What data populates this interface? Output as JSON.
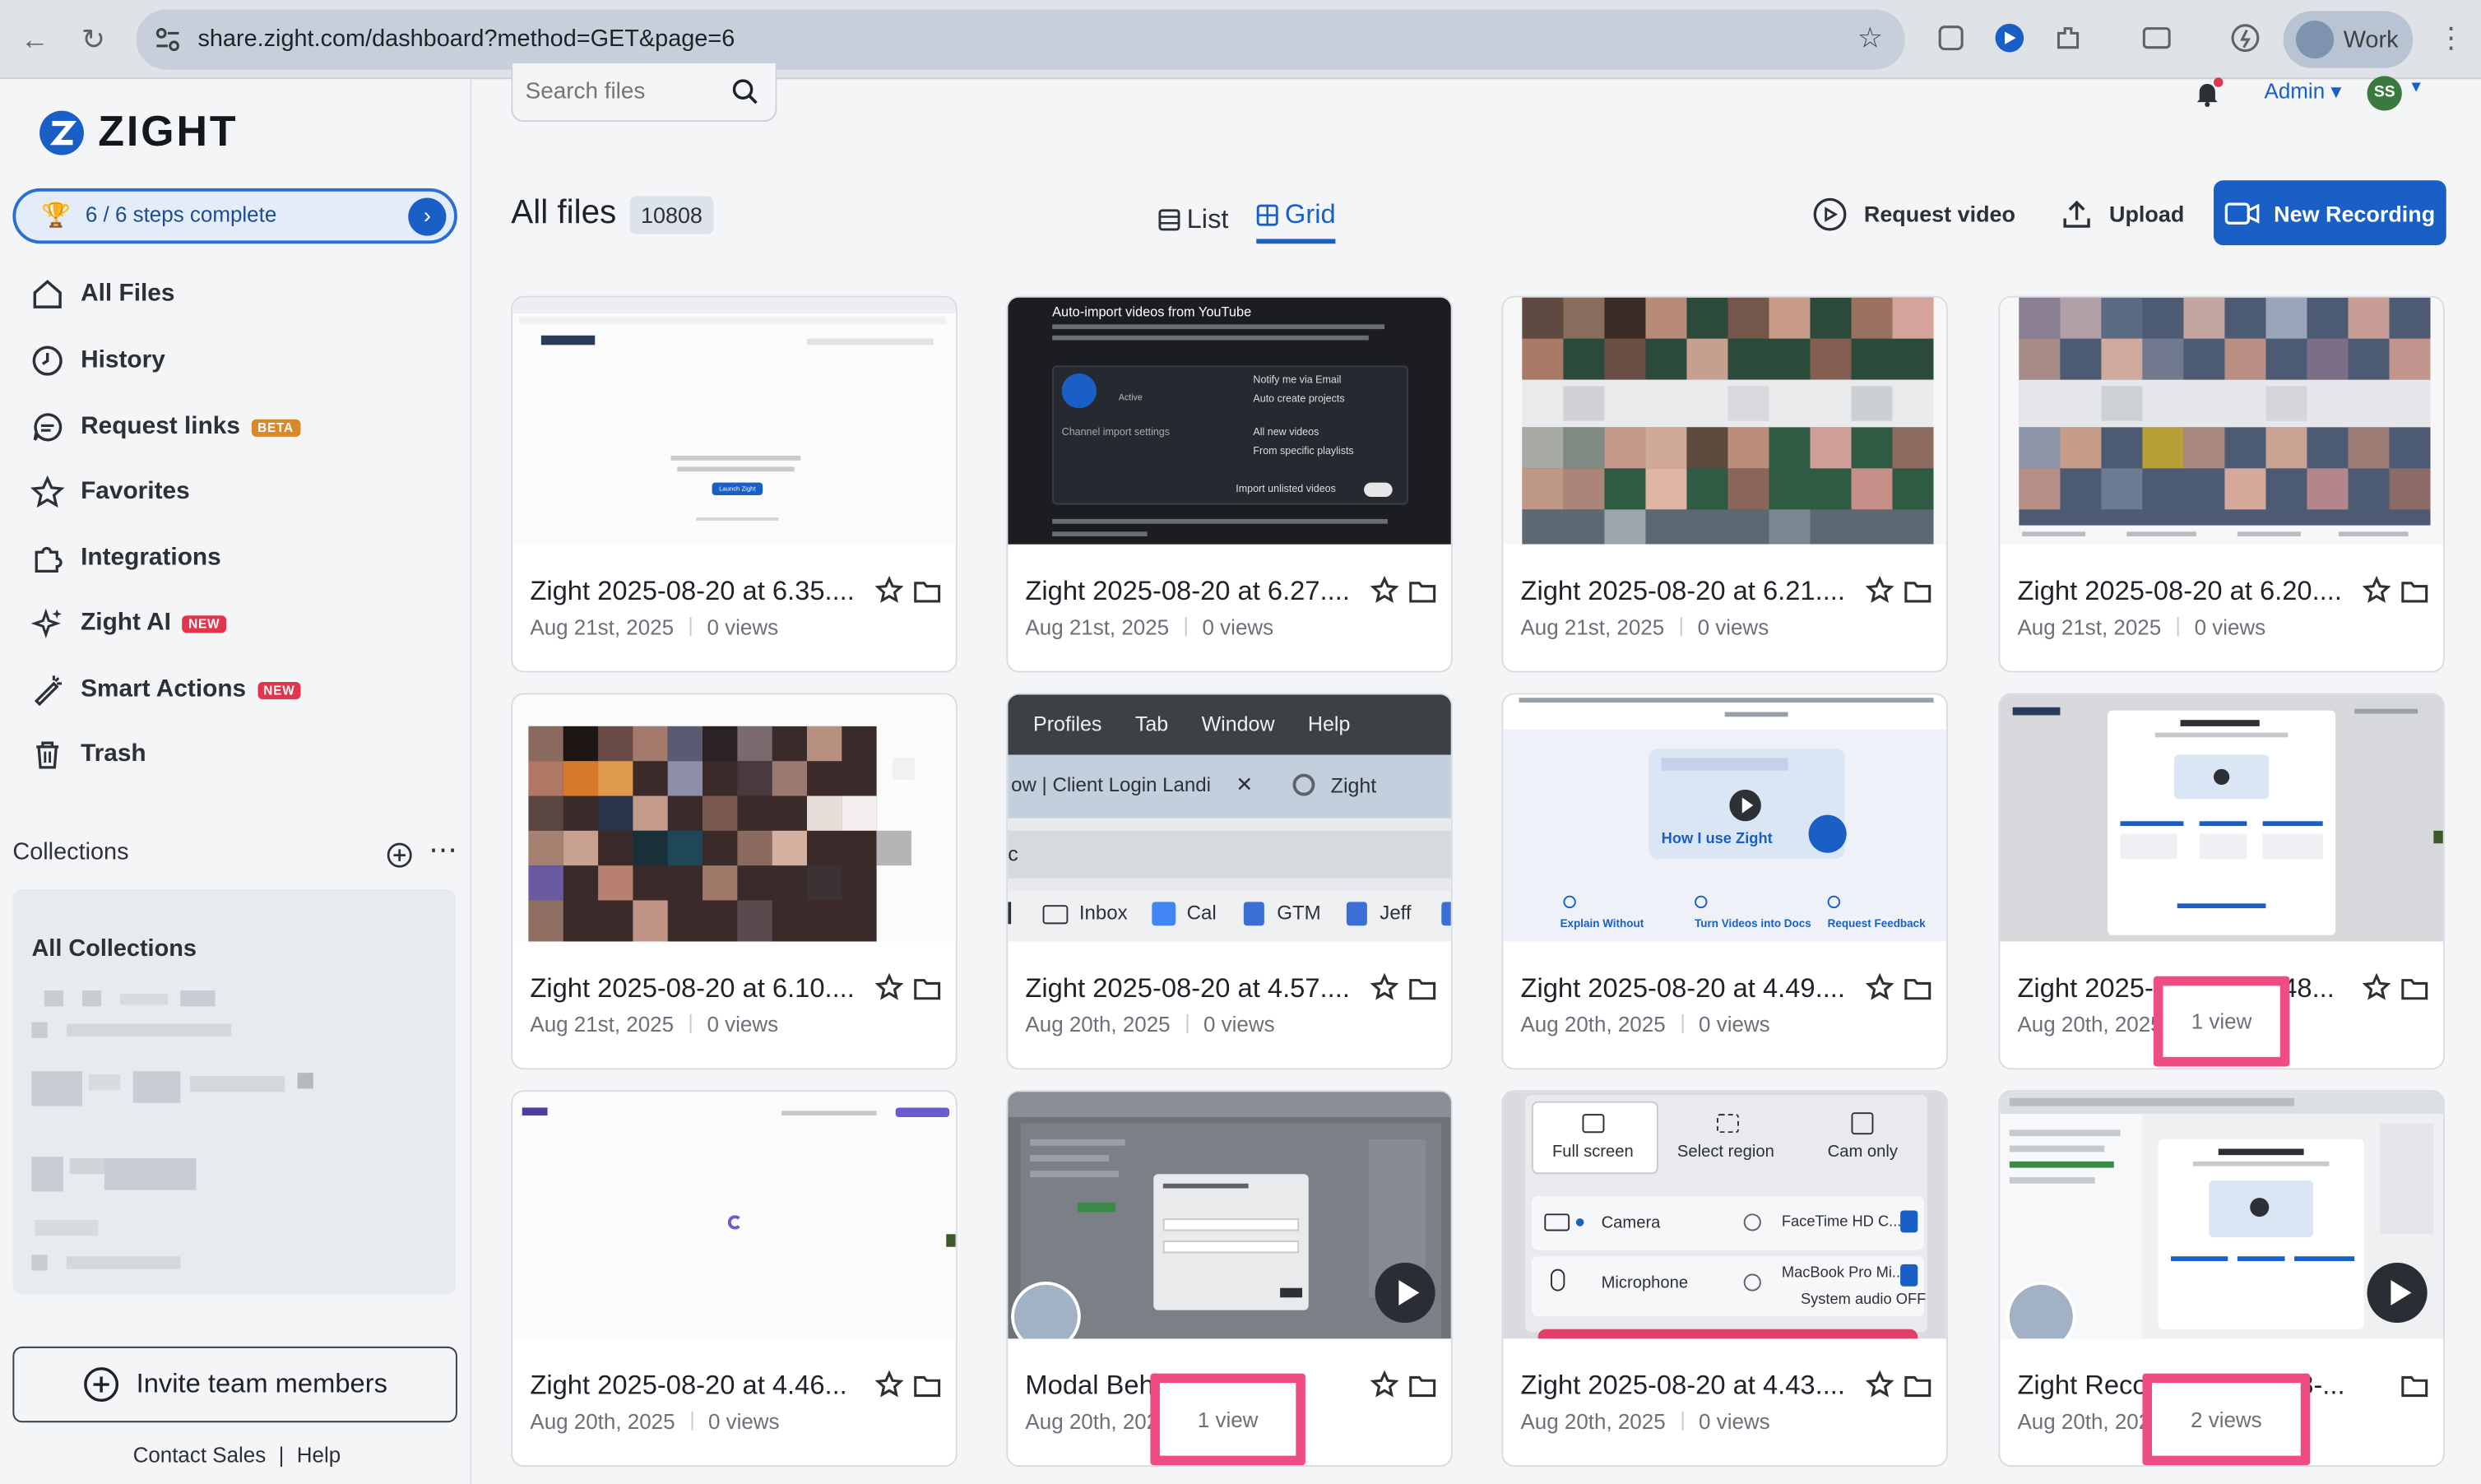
{
  "browser": {
    "url": "share.zight.com/dashboard?method=GET&page=6",
    "profile_label": "Work"
  },
  "brand": {
    "name": "ZIGHT",
    "accent": "#1a5fc6",
    "highlight": "#ef4b84"
  },
  "sidebar": {
    "steps": "6 / 6 steps complete",
    "items": [
      {
        "label": "All Files",
        "icon": "home-icon"
      },
      {
        "label": "History",
        "icon": "clock-icon"
      },
      {
        "label": "Request links",
        "icon": "chat-icon",
        "badge": "BETA"
      },
      {
        "label": "Favorites",
        "icon": "star-icon"
      },
      {
        "label": "Integrations",
        "icon": "puzzle-icon"
      },
      {
        "label": "Zight AI",
        "icon": "sparkle-icon",
        "badge": "NEW"
      },
      {
        "label": "Smart Actions",
        "icon": "wand-icon",
        "badge": "NEW"
      },
      {
        "label": "Trash",
        "icon": "trash-icon"
      }
    ],
    "collections_title": "Collections",
    "all_collections": "All Collections",
    "invite": "Invite team members",
    "contact_sales": "Contact Sales",
    "help": "Help"
  },
  "header": {
    "search_placeholder": "Search files",
    "admin": "Admin",
    "user_initials": "SS"
  },
  "main": {
    "title": "All files",
    "count": "10808",
    "view_list": "List",
    "view_grid": "Grid",
    "request_video": "Request video",
    "upload": "Upload",
    "new_recording": "New Recording"
  },
  "files": [
    {
      "name": "Zight 2025-08-20 at 6.35....",
      "date": "Aug 21st, 2025",
      "views": "0 views"
    },
    {
      "name": "Zight 2025-08-20 at 6.27....",
      "date": "Aug 21st, 2025",
      "views": "0 views"
    },
    {
      "name": "Zight 2025-08-20 at 6.21....",
      "date": "Aug 21st, 2025",
      "views": "0 views"
    },
    {
      "name": "Zight 2025-08-20 at 6.20....",
      "date": "Aug 21st, 2025",
      "views": "0 views"
    },
    {
      "name": "Zight 2025-08-20 at 6.10....",
      "date": "Aug 21st, 2025",
      "views": "0 views"
    },
    {
      "name": "Zight 2025-08-20 at 4.57....",
      "date": "Aug 20th, 2025",
      "views": "0 views"
    },
    {
      "name": "Zight 2025-08-20 at 4.49....",
      "date": "Aug 20th, 2025",
      "views": "0 views"
    },
    {
      "name": "Zight 2025-08-20 at 4.48...",
      "date": "Aug 20th, 2025",
      "views": "1 view"
    },
    {
      "name": "Zight 2025-08-20 at 4.46...",
      "date": "Aug 20th, 2025",
      "views": "0 views"
    },
    {
      "name": "Modal Behavior Testing",
      "date": "Aug 20th, 2025",
      "views": "1 view"
    },
    {
      "name": "Zight 2025-08-20 at 4.43....",
      "date": "Aug 20th, 2025",
      "views": "0 views"
    },
    {
      "name": "Zight Recording 2025-08-...",
      "date": "Aug 20th, 2025",
      "views": "2 views"
    }
  ],
  "thumbs": {
    "t1_launch": "Launch Zight",
    "t2_title": "Auto-import videos from YouTube",
    "t2_notify": "Notify me via Email",
    "t2_auto": "Auto create projects",
    "t2_all": "All new videos",
    "t2_playlists": "From specific playlists",
    "t2_unlisted": "Import unlisted videos",
    "t2_channel": "Channel import settings",
    "t2_active": "Active",
    "t6_menu": [
      "Profiles",
      "Tab",
      "Window",
      "Help"
    ],
    "t6_tab": "ow | Client Login Landi",
    "t6_tab2": "Zight",
    "t6_bookmarks": [
      "Inbox",
      "Cal",
      "GTM",
      "Jeff"
    ],
    "t7_how": "How I use Zight",
    "t7_explain": "Explain Without",
    "t7_turn": "Turn Videos into Docs",
    "t7_request": "Request Feedback",
    "t11_full": "Full screen",
    "t11_region": "Select region",
    "t11_cam": "Cam only",
    "t11_camera": "Camera",
    "t11_camera_val": "FaceTime HD C...",
    "t11_mic": "Microphone",
    "t11_mic_val": "MacBook Pro Mi...",
    "t11_audio": "System audio OFF"
  }
}
